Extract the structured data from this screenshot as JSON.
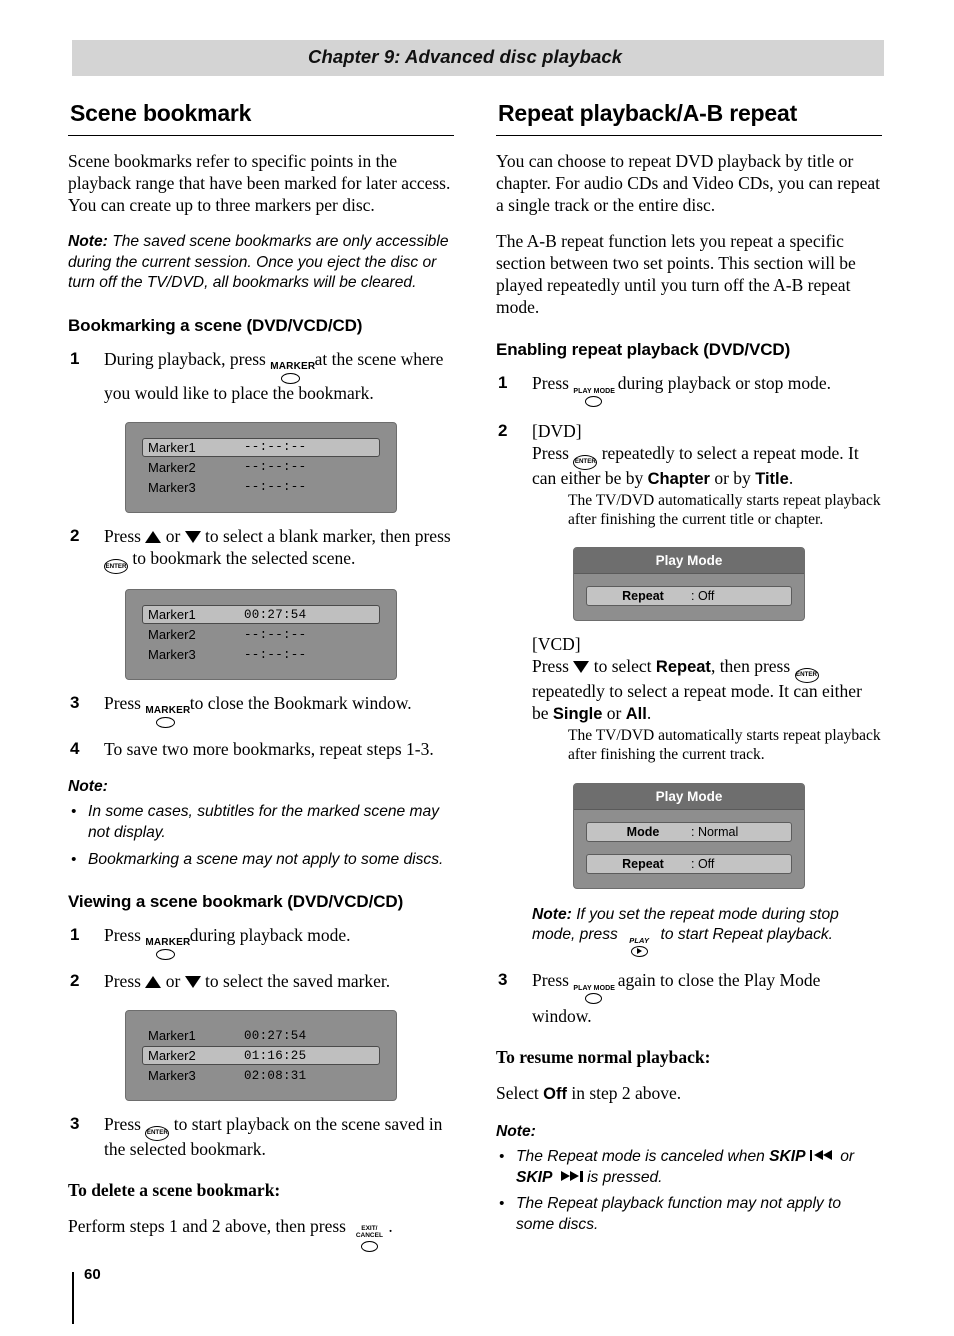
{
  "header": {
    "chapter": "Chapter 9: Advanced disc playback"
  },
  "page_number": "60",
  "left": {
    "title": "Scene bookmark",
    "intro": "Scene bookmarks refer to specific points in the playback range that have been marked for later access. You can create up to three markers per disc.",
    "note_label": "Note:",
    "note_text": " The saved scene bookmarks are only accessible during the current session. Once you eject the disc or turn off the TV/DVD, all bookmarks will be cleared.",
    "sub1": "Bookmarking a scene (DVD/VCD/CD)",
    "step1_num": "1",
    "step1_a": "During playback, press",
    "step1_b": "at the scene where you would like to place the bookmark.",
    "osd1": {
      "rows": [
        {
          "label": "Marker1",
          "time": "--:--:--",
          "selected": true
        },
        {
          "label": "Marker2",
          "time": "--:--:--",
          "selected": false
        },
        {
          "label": "Marker3",
          "time": "--:--:--",
          "selected": false
        }
      ]
    },
    "step2_num": "2",
    "step2_a": "Press",
    "step2_or": "or",
    "step2_b": "to select a blank marker, then press",
    "step2_c": "to bookmark the selected scene.",
    "osd2": {
      "rows": [
        {
          "label": "Marker1",
          "time": "00:27:54",
          "selected": true
        },
        {
          "label": "Marker2",
          "time": "--:--:--",
          "selected": false
        },
        {
          "label": "Marker3",
          "time": "--:--:--",
          "selected": false
        }
      ]
    },
    "step3_num": "3",
    "step3_a": "Press",
    "step3_b": "to close the Bookmark window.",
    "step4_num": "4",
    "step4_text": "To save two more bookmarks, repeat steps 1-3.",
    "note_head": "Note:",
    "notes": [
      "In some cases, subtitles for the marked scene may not display.",
      "Bookmarking a scene may not apply to some discs."
    ],
    "sub2": "Viewing a scene bookmark (DVD/VCD/CD)",
    "v_step1_num": "1",
    "v_step1_a": "Press",
    "v_step1_b": "during playback mode.",
    "v_step2_num": "2",
    "v_step2_a": "Press",
    "v_step2_or": "or",
    "v_step2_b": "to select the saved marker.",
    "osd3": {
      "rows": [
        {
          "label": "Marker1",
          "time": "00:27:54",
          "selected": false
        },
        {
          "label": "Marker2",
          "time": "01:16:25",
          "selected": true
        },
        {
          "label": "Marker3",
          "time": "02:08:31",
          "selected": false
        }
      ]
    },
    "v_step3_num": "3",
    "v_step3_a": "Press",
    "v_step3_b": "to start playback on the scene saved in the selected bookmark.",
    "delete_head": "To delete a scene bookmark:",
    "delete_a": "Perform steps 1 and 2 above, then press",
    "delete_b": "."
  },
  "right": {
    "title": "Repeat playback/A-B repeat",
    "p1": "You can choose to repeat DVD playback by title or chapter. For audio CDs and Video CDs, you can repeat a single track or the entire disc.",
    "p2": "The A-B repeat function lets you repeat a specific section between two set points. This section will be played repeatedly until you turn off the A-B repeat mode.",
    "sub1": "Enabling repeat playback (DVD/VCD)",
    "step1_num": "1",
    "step1_a": "Press",
    "step1_b": "during playback or stop mode.",
    "step2_num": "2",
    "step2_dvd": "[DVD]",
    "step2_a": "Press",
    "step2_b": "repeatedly to select a repeat mode. It can either be by",
    "step2_chapter": "Chapter",
    "step2_or": "or by",
    "step2_title": "Title",
    "step2_period": ".",
    "step2_sub": "The TV/DVD automatically starts repeat playback after finishing the current title or chapter.",
    "osd1": {
      "title": "Play Mode",
      "rows": [
        {
          "key": "Repeat",
          "value": ": Off",
          "boxed": true
        }
      ]
    },
    "vcd_tag": "[VCD]",
    "vcd_a": "Press",
    "vcd_b": "to select",
    "vcd_repeat": "Repeat",
    "vcd_c": ", then press",
    "vcd_d": "repeatedly to select a repeat mode. It can either be",
    "vcd_single": "Single",
    "vcd_or": "or",
    "vcd_all": "All",
    "vcd_period": ".",
    "vcd_sub": "The TV/DVD automatically starts repeat playback after finishing the current track.",
    "osd2": {
      "title": "Play Mode",
      "rows": [
        {
          "key": "Mode",
          "value": ": Normal",
          "boxed": true
        },
        {
          "key": "Repeat",
          "value": ": Off",
          "boxed": true
        }
      ]
    },
    "note_label": "Note:",
    "note_a": " If you set the repeat mode during stop mode, press",
    "note_b": "to start Repeat playback.",
    "step3_num": "3",
    "step3_a": "Press",
    "step3_b": "again to close the Play Mode window.",
    "resume_head": "To resume normal playback:",
    "resume_a": "Select",
    "resume_off": "Off",
    "resume_b": "in step 2 above.",
    "note_head": "Note:",
    "note1_a": "The Repeat mode is canceled when",
    "note1_skip1": "SKIP",
    "note1_or": "or",
    "note1_skip2": "SKIP",
    "note1_b": "is pressed.",
    "note2": "The Repeat playback function may not apply to some discs."
  },
  "buttons": {
    "marker": "MARKER",
    "enter": "ENTER",
    "play": "PLAY",
    "play_mode": "PLAY MODE",
    "exit_line1": "EXIT/",
    "exit_line2": "CANCEL"
  }
}
